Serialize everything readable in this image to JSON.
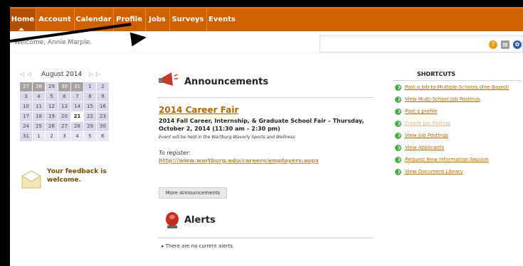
{
  "nav": {
    "items": [
      {
        "label": "Home",
        "active": true
      },
      {
        "label": "Account"
      },
      {
        "label": "Calendar"
      },
      {
        "label": "Profile"
      },
      {
        "label": "Jobs"
      },
      {
        "label": "Surveys"
      },
      {
        "label": "Events"
      }
    ]
  },
  "header": {
    "welcome": "Welcome, Annie Marple."
  },
  "calendar": {
    "title": "August 2014",
    "days": [
      {
        "d": "27",
        "c": "prev"
      },
      {
        "d": "28",
        "c": "prev"
      },
      {
        "d": "29",
        "c": "cur"
      },
      {
        "d": "30",
        "c": "prev"
      },
      {
        "d": "31",
        "c": "prev"
      },
      {
        "d": "1",
        "c": "cur"
      },
      {
        "d": "2",
        "c": "cur"
      },
      {
        "d": "3",
        "c": "cur"
      },
      {
        "d": "4",
        "c": "cur"
      },
      {
        "d": "5",
        "c": "cur"
      },
      {
        "d": "6",
        "c": "cur"
      },
      {
        "d": "7",
        "c": "cur"
      },
      {
        "d": "8",
        "c": "cur"
      },
      {
        "d": "9",
        "c": "cur"
      },
      {
        "d": "10",
        "c": "cur"
      },
      {
        "d": "11",
        "c": "cur"
      },
      {
        "d": "12",
        "c": "cur"
      },
      {
        "d": "13",
        "c": "cur"
      },
      {
        "d": "14",
        "c": "cur"
      },
      {
        "d": "15",
        "c": "cur"
      },
      {
        "d": "16",
        "c": "cur"
      },
      {
        "d": "17",
        "c": "cur"
      },
      {
        "d": "18",
        "c": "cur"
      },
      {
        "d": "19",
        "c": "cur"
      },
      {
        "d": "20",
        "c": "cur"
      },
      {
        "d": "21",
        "c": "today"
      },
      {
        "d": "22",
        "c": "cur"
      },
      {
        "d": "23",
        "c": "cur"
      },
      {
        "d": "24",
        "c": "cur"
      },
      {
        "d": "25",
        "c": "cur"
      },
      {
        "d": "26",
        "c": "cur"
      },
      {
        "d": "27",
        "c": "cur"
      },
      {
        "d": "28",
        "c": "cur"
      },
      {
        "d": "29",
        "c": "cur"
      },
      {
        "d": "30",
        "c": "cur"
      },
      {
        "d": "31",
        "c": "cur"
      },
      {
        "d": "1",
        "c": "next"
      },
      {
        "d": "2",
        "c": "next"
      },
      {
        "d": "3",
        "c": "next"
      },
      {
        "d": "4",
        "c": "next"
      },
      {
        "d": "5",
        "c": "next"
      },
      {
        "d": "6",
        "c": "next"
      }
    ]
  },
  "feedback": {
    "text": "Your feedback is welcome."
  },
  "announcements": {
    "title": "Announcements",
    "fair_title": "2014 Career Fair",
    "fair_sub": "2014 Fall Career, Internship, & Graduate School Fair – Thursday, October 2, 2014 (11:30 am – 2:30 pm)",
    "fair_note": "Event will be held in the Wartburg-Waverly Sports and Wellness",
    "register_label": "To register:",
    "register_link": "http://www.wartburg.edu/careers/employers.aspx",
    "more_button": "More Announcements"
  },
  "alerts": {
    "title": "Alerts",
    "none": "There are no current alerts."
  },
  "shortcuts": {
    "title": "SHORTCUTS",
    "items": [
      {
        "label": "Post a Job to Multiple Schools (Fee Based)"
      },
      {
        "label": "View Multi-School Job Postings"
      },
      {
        "label": "Post a profile"
      },
      {
        "label": "Create Job Posting",
        "faded": true
      },
      {
        "label": "View Job Postings"
      },
      {
        "label": "View Applicants"
      },
      {
        "label": "Request New Information Session"
      },
      {
        "label": "View Document Library"
      }
    ]
  },
  "colors": {
    "nav": "#cf6000",
    "link": "#b26a00"
  }
}
